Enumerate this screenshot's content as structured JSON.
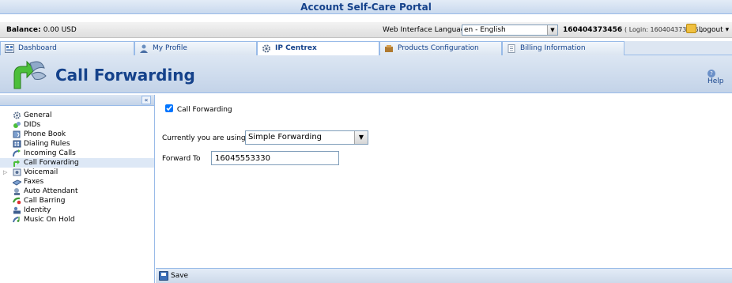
{
  "app": {
    "title": "Account Self-Care Portal"
  },
  "status": {
    "balance_label": "Balance:",
    "balance_value": "0.00 USD",
    "language_label": "Web Interface Language:",
    "language_value": "en - English",
    "account_id": "160404373456",
    "login_text": "( Login: 160404373456 )",
    "logout_label": "Logout"
  },
  "tabs": [
    {
      "label": "Dashboard",
      "icon": "dashboard-icon"
    },
    {
      "label": "My Profile",
      "icon": "user-icon"
    },
    {
      "label": "IP Centrex",
      "icon": "gear-icon",
      "active": true
    },
    {
      "label": "Products Configuration",
      "icon": "products-icon"
    },
    {
      "label": "Billing Information",
      "icon": "document-icon"
    }
  ],
  "header": {
    "title": "Call Forwarding",
    "help_label": "Help",
    "collapse_glyph": "«"
  },
  "sidebar": {
    "items": [
      {
        "label": "General",
        "icon": "gear-icon"
      },
      {
        "label": "DIDs",
        "icon": "did-icon"
      },
      {
        "label": "Phone Book",
        "icon": "phone-book-icon"
      },
      {
        "label": "Dialing Rules",
        "icon": "dialing-rules-icon"
      },
      {
        "label": "Incoming Calls",
        "icon": "incoming-calls-icon"
      },
      {
        "label": "Call Forwarding",
        "icon": "call-forwarding-icon",
        "active": true
      },
      {
        "label": "Voicemail",
        "icon": "voicemail-icon",
        "expandable": true
      },
      {
        "label": "Faxes",
        "icon": "fax-icon"
      },
      {
        "label": "Auto Attendant",
        "icon": "auto-attendant-icon"
      },
      {
        "label": "Call Barring",
        "icon": "call-barring-icon"
      },
      {
        "label": "Identity",
        "icon": "identity-icon"
      },
      {
        "label": "Music On Hold",
        "icon": "music-icon"
      }
    ]
  },
  "form": {
    "checkbox_label": "Call Forwarding",
    "checkbox_checked": true,
    "using_label": "Currently you are using",
    "using_value": "Simple Forwarding",
    "forward_label": "Forward To",
    "forward_value": "16045553330"
  },
  "footer": {
    "save_label": "Save"
  }
}
